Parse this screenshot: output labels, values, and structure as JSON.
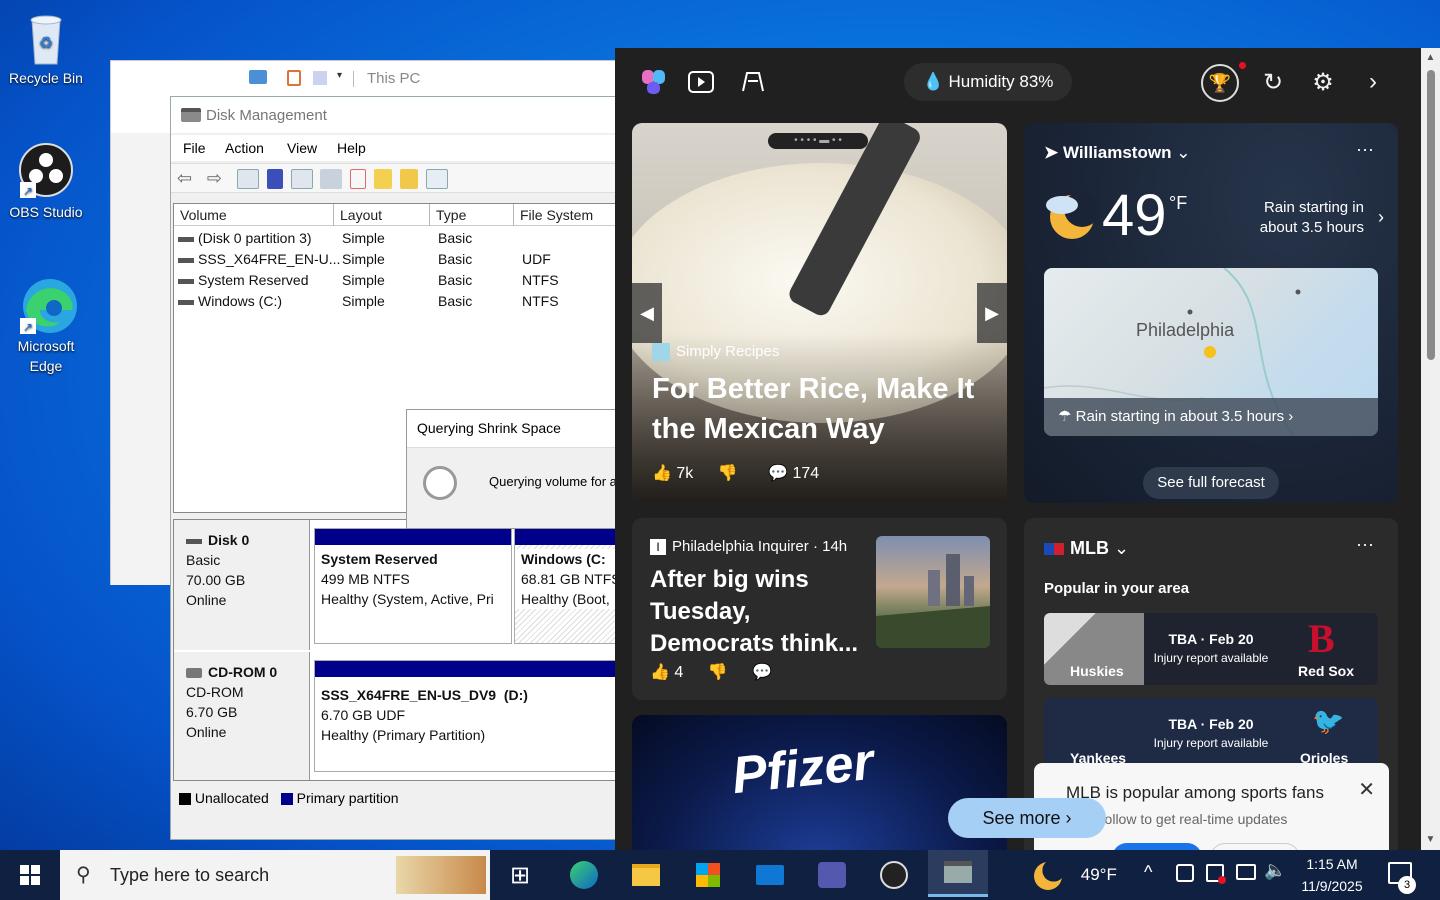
{
  "desktop": {
    "icons": [
      {
        "label": "Recycle Bin"
      },
      {
        "label": "OBS Studio"
      },
      {
        "label": "Microsoft Edge"
      }
    ]
  },
  "explorer": {
    "address": "This PC"
  },
  "disk_mgmt": {
    "title": "Disk Management",
    "menu": [
      "File",
      "Action",
      "View",
      "Help"
    ],
    "columns": [
      "Volume",
      "Layout",
      "Type",
      "File System"
    ],
    "volumes": [
      {
        "name": "(Disk 0 partition 3)",
        "layout": "Simple",
        "type": "Basic",
        "fs": ""
      },
      {
        "name": "SSS_X64FRE_EN-U...",
        "layout": "Simple",
        "type": "Basic",
        "fs": "UDF"
      },
      {
        "name": "System Reserved",
        "layout": "Simple",
        "type": "Basic",
        "fs": "NTFS"
      },
      {
        "name": "Windows (C:)",
        "layout": "Simple",
        "type": "Basic",
        "fs": "NTFS"
      }
    ],
    "disk0": {
      "name": "Disk 0",
      "type": "Basic",
      "size": "70.00 GB",
      "status": "Online",
      "p1": {
        "name": "System Reserved",
        "size": "499 MB NTFS",
        "health": "Healthy (System, Active, Pri"
      },
      "p2": {
        "name": "Windows  (C:",
        "size": "68.81 GB NTFS",
        "health": "Healthy (Boot,"
      }
    },
    "cdrom0": {
      "name": "CD-ROM 0",
      "type": "CD-ROM",
      "size": "6.70 GB",
      "status": "Online",
      "p1": {
        "name": "SSS_X64FRE_EN-US_DV9  (D:)",
        "size": "6.70 GB UDF",
        "health": "Healthy (Primary Partition)"
      }
    },
    "legend": {
      "unallocated": "Unallocated",
      "primary": "Primary partition"
    },
    "dialog": {
      "title": "Querying Shrink Space",
      "message": "Querying volume for a"
    }
  },
  "widgets": {
    "humidity": "Humidity 83%",
    "hero": {
      "source": "Simply Recipes",
      "title": "For Better Rice, Make It the Mexican Way",
      "likes": "7k",
      "comments": "174"
    },
    "weather": {
      "location": "Williamstown",
      "temp": "49",
      "unit": "°F",
      "forecast": "Rain starting in about 3.5 hours",
      "map_city": "Philadelphia",
      "map_caption": "Rain starting in about 3.5 hours",
      "button": "See full forecast"
    },
    "news": {
      "source": "Philadelphia Inquirer",
      "age": "· 14h",
      "title": "After big wins Tuesday, Democrats think...",
      "likes": "4"
    },
    "pfizer": {
      "logo": "Pfizer"
    },
    "mlb": {
      "title": "MLB",
      "subtitle": "Popular in your area",
      "games": [
        {
          "when": "TBA · Feb 20",
          "note": "Injury report available",
          "home": "Huskies",
          "away": "Red Sox"
        },
        {
          "when": "TBA · Feb 20",
          "note": "Injury report available",
          "home": "Yankees",
          "away": "Orioles"
        }
      ],
      "toast_title": "MLB is popular among sports fans",
      "toast_sub": "Follow to get real-time updates"
    },
    "see_more": "See more"
  },
  "taskbar": {
    "search": "Type here to search",
    "temp": "49°F",
    "time": "1:15 AM",
    "date": "11/9/2025",
    "notifications": "3"
  },
  "colors": {
    "primary_partition": "#00008b",
    "unallocated": "#000000",
    "widget_bg": "#202020",
    "accent": "#0a78e0"
  }
}
